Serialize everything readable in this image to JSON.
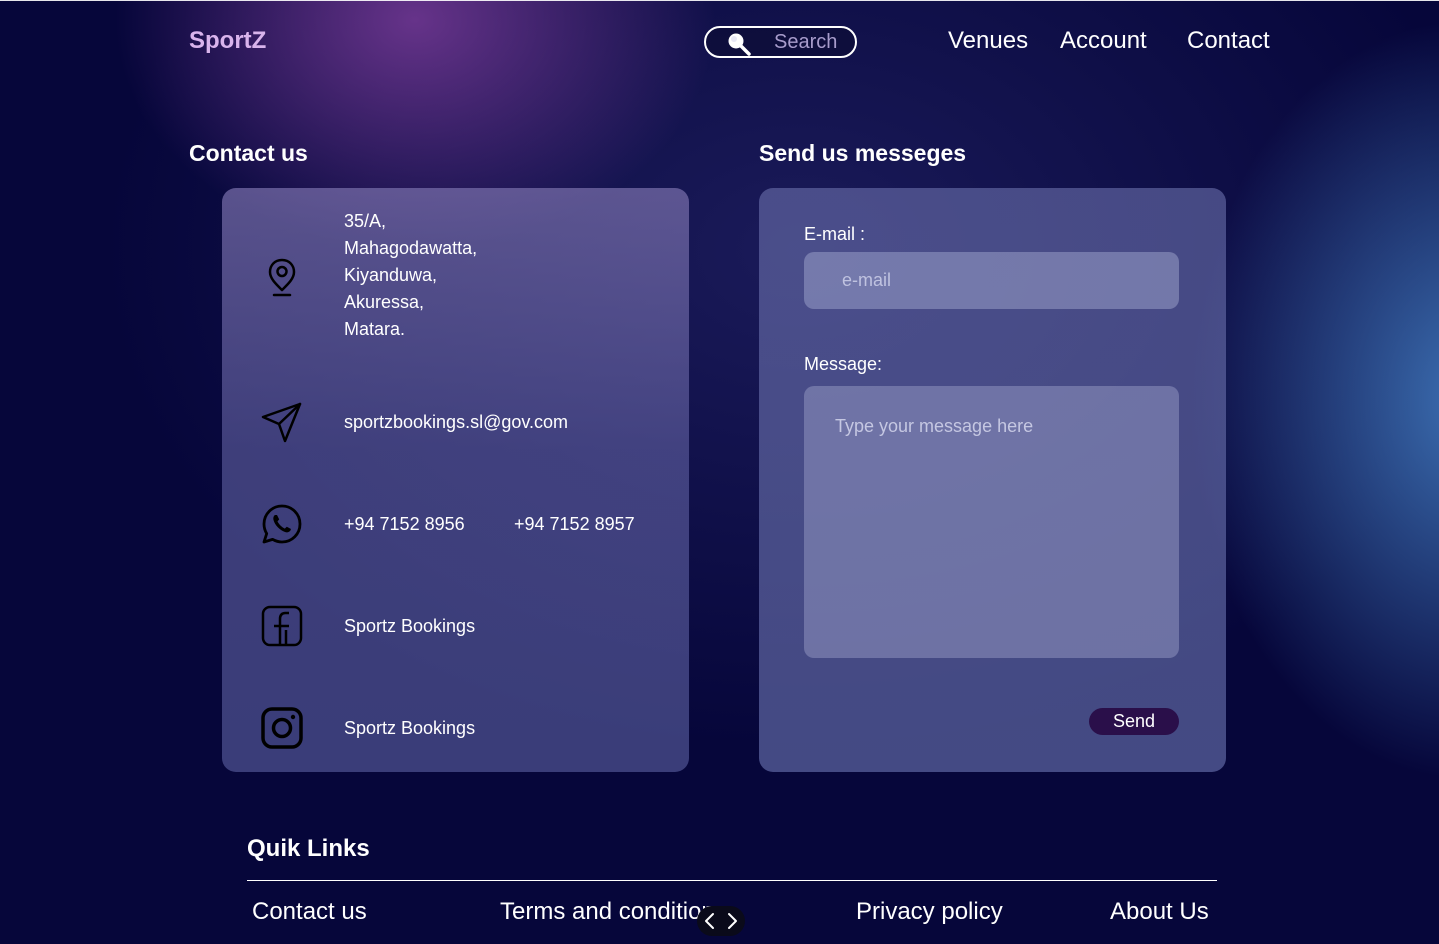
{
  "header": {
    "logo": "SportZ",
    "search": {
      "placeholder": "Search",
      "icon": "search-icon"
    },
    "nav": [
      "Venues",
      "Account",
      "Contact"
    ]
  },
  "contact_section": {
    "title": "Contact us",
    "address_lines": [
      "35/A,",
      "Mahagodawatta,",
      "Kiyanduwa,",
      "Akuressa,",
      "Matara."
    ],
    "email": "sportzbookings.sl@gov.com",
    "phones": [
      "+94 7152 8956",
      "+94 7152 8957"
    ],
    "facebook": "Sportz Bookings",
    "instagram": "Sportz Bookings",
    "icons": [
      "location-pin-icon",
      "send-icon",
      "whatsapp-icon",
      "facebook-icon",
      "instagram-icon"
    ]
  },
  "message_section": {
    "title": "Send us messeges",
    "email_label": "E-mail :",
    "email_placeholder": "e-mail",
    "message_label": "Message:",
    "message_placeholder": "Type your message here",
    "send_label": "Send"
  },
  "footer": {
    "title": "Quik Links",
    "links": [
      "Contact us",
      "Terms and conditions",
      "Privacy policy",
      "About Us"
    ]
  },
  "colors": {
    "logo": "#d9b4ec",
    "send_button": "#2a0f4a",
    "background": "#06063a"
  }
}
